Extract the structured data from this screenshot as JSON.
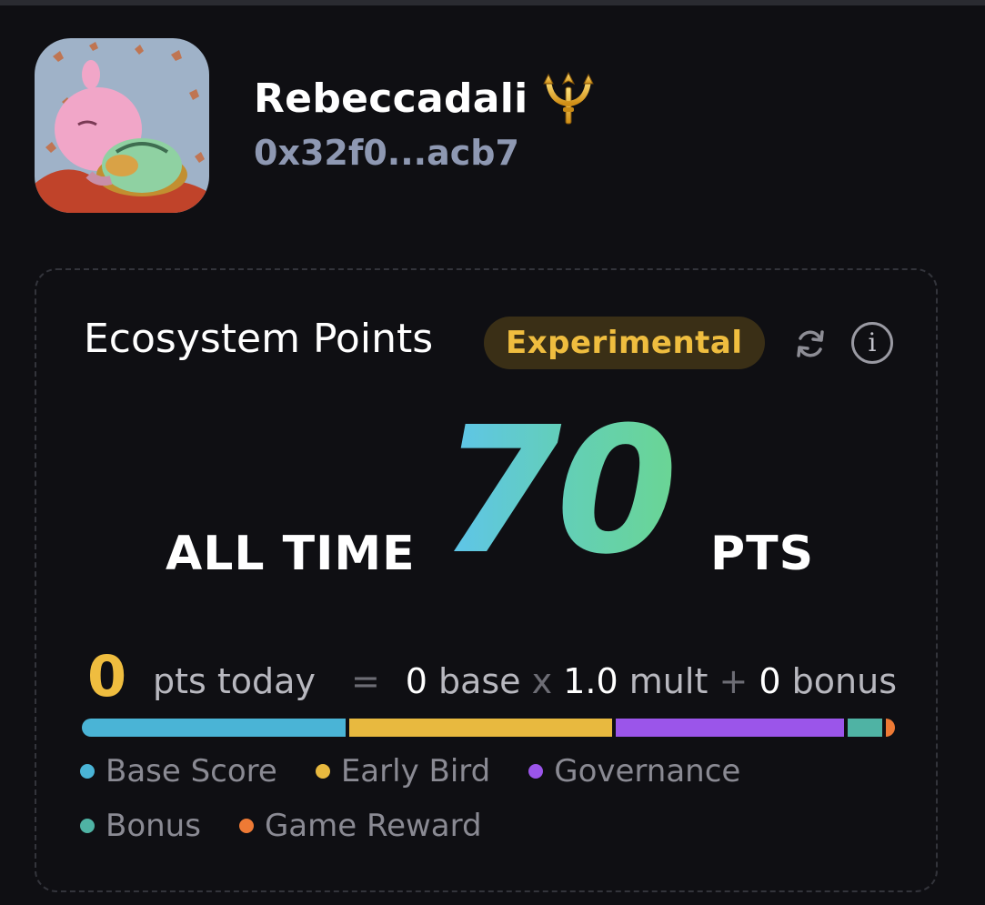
{
  "profile": {
    "username": "Rebeccadali",
    "wallet": "0x32f0...acb7"
  },
  "points_card": {
    "title": "Ecosystem Points",
    "badge": "Experimental",
    "info_glyph": "i",
    "all_time_label": "ALL TIME",
    "all_time_value": "70",
    "all_time_unit": "PTS",
    "today_value": "0",
    "today_label": "pts today",
    "equals": "=",
    "base_value": "0",
    "base_label": "base",
    "times": "x",
    "mult_value": "1.0",
    "mult_label": "mult",
    "plus": "+",
    "bonus_value": "0",
    "bonus_label": "bonus"
  },
  "breakdown": [
    {
      "label": "Base Score",
      "color": "#4ab4d6",
      "share": 0.33
    },
    {
      "label": "Early Bird",
      "color": "#e8b93f",
      "share": 0.33
    },
    {
      "label": "Governance",
      "color": "#9b55ea",
      "share": 0.286
    },
    {
      "label": "Bonus",
      "color": "#4fb3a4",
      "share": 0.043
    },
    {
      "label": "Game Reward",
      "color": "#ee7a35",
      "share": 0.011
    }
  ],
  "colors": {
    "background": "#0f0f13",
    "accent_yellow": "#efbd3f",
    "wallet_text": "#8e98b2",
    "points_gradient_start": "#5ec4ee",
    "points_gradient_end": "#6ad595"
  },
  "icons": [
    "trident-icon",
    "refresh-icon",
    "info-icon"
  ]
}
